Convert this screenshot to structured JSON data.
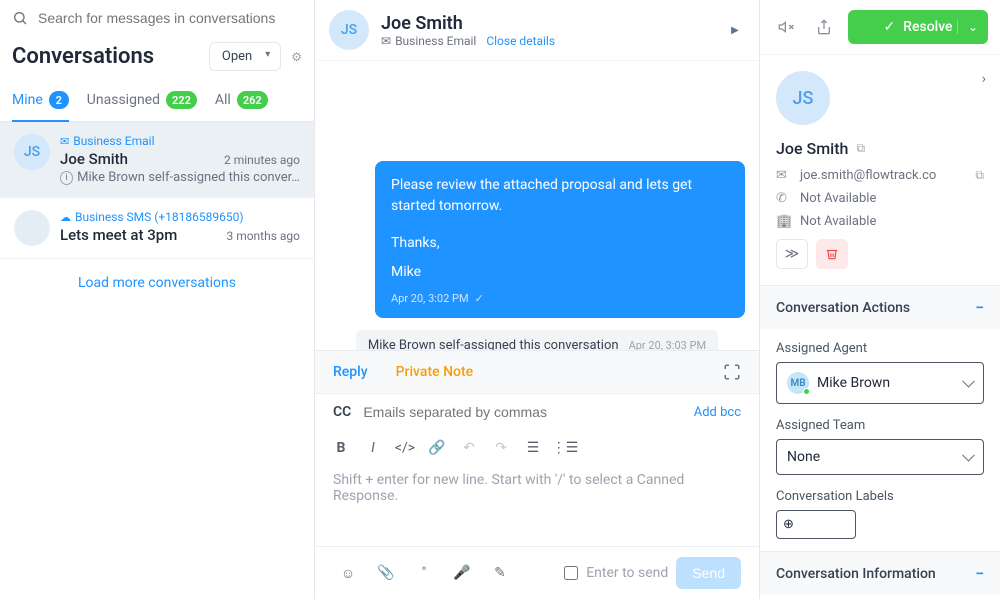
{
  "search_placeholder": "Search for messages in conversations",
  "conversations_title": "Conversations",
  "open_filter": "Open",
  "tabs": {
    "mine": {
      "label": "Mine",
      "count": "2"
    },
    "unassigned": {
      "label": "Unassigned",
      "count": "222"
    },
    "all": {
      "label": "All",
      "count": "262"
    }
  },
  "list": [
    {
      "channel": "Business Email",
      "channel_icon": "✉",
      "name": "Joe Smith",
      "time": "2 minutes ago",
      "preview": "Mike Brown self-assigned this conver…",
      "initials": "JS",
      "active": true,
      "has_info": true
    },
    {
      "channel": "Business SMS (+18186589650)",
      "channel_icon": "☁",
      "name": "",
      "time": "3 months ago",
      "preview": "Lets meet at 3pm",
      "initials": "",
      "active": false,
      "has_info": false
    }
  ],
  "load_more": "Load more conversations",
  "thread": {
    "name": "Joe Smith",
    "initials": "JS",
    "channel": "Business Email",
    "close_details": "Close details",
    "message_body": "Please review the attached proposal and lets get started tomorrow.",
    "message_thanks": "Thanks,",
    "message_sign": "Mike",
    "message_time": "Apr 20, 3:02 PM",
    "assigned_note": "Mike Brown self-assigned this conversation",
    "assigned_time": "Apr 20, 3:03 PM"
  },
  "composer": {
    "reply": "Reply",
    "private_note": "Private Note",
    "cc": "CC",
    "cc_placeholder": "Emails separated by commas",
    "add_bcc": "Add bcc",
    "body_placeholder": "Shift + enter for new line. Start with '/' to select a Canned Response.",
    "enter_to_send": "Enter to send",
    "send": "Send"
  },
  "top_actions": {
    "resolve": "Resolve"
  },
  "profile": {
    "initials": "JS",
    "name": "Joe Smith",
    "email": "joe.smith@flowtrack.co",
    "phone": "Not Available",
    "company": "Not Available"
  },
  "actions_section": {
    "title": "Conversation Actions",
    "assigned_agent_label": "Assigned Agent",
    "assigned_agent": "Mike Brown",
    "assigned_agent_initials": "MB",
    "assigned_team_label": "Assigned Team",
    "assigned_team": "None",
    "labels_label": "Conversation Labels",
    "label_add": "⊕"
  },
  "info_section": {
    "title": "Conversation Information"
  }
}
